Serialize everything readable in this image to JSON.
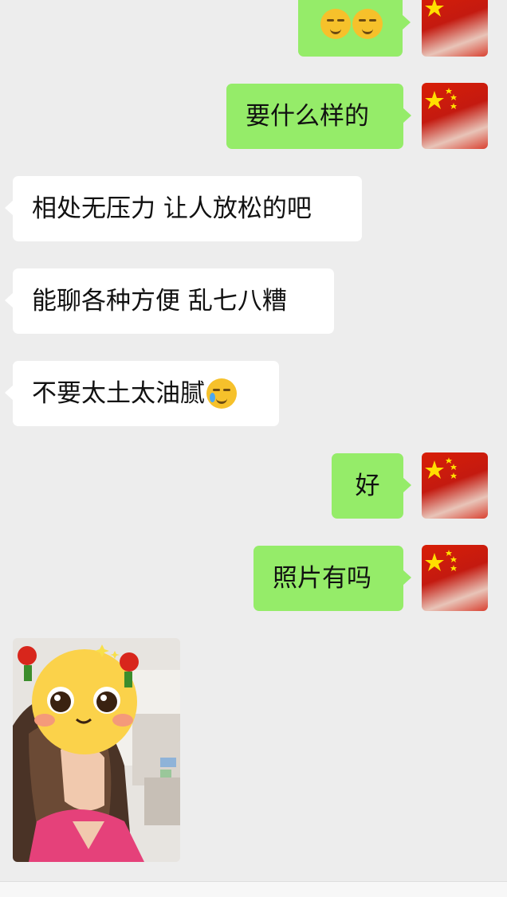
{
  "messages": [
    {
      "side": "out",
      "text": "",
      "has_emoji": true,
      "emoji": [
        "smirk-face-emoji",
        "smirk-face-emoji"
      ]
    },
    {
      "side": "out",
      "text": "要什么样的"
    },
    {
      "side": "in",
      "text": "相处无压力 让人放松的吧"
    },
    {
      "side": "in",
      "text": "能聊各种方便 乱七八糟"
    },
    {
      "side": "in",
      "text": "不要太土太油腻",
      "emoji": [
        "crying-laughing-emoji"
      ]
    },
    {
      "side": "out",
      "text": "好"
    },
    {
      "side": "out",
      "text": "照片有吗"
    },
    {
      "side": "in",
      "type": "image",
      "image": "photo-with-emoji-sticker-over-face"
    }
  ],
  "colors": {
    "background": "#ededed",
    "outgoing_bubble": "#95ec69",
    "incoming_bubble": "#ffffff"
  }
}
